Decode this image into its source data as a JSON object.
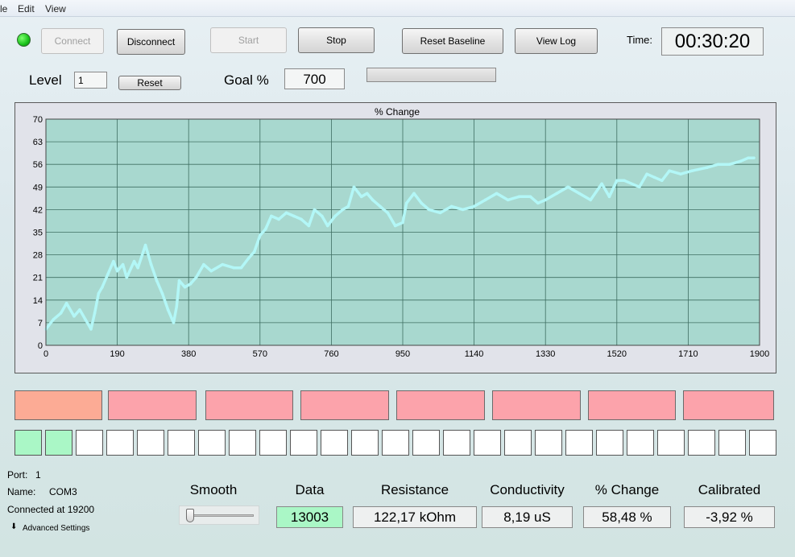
{
  "menu": {
    "file": "le",
    "edit": "Edit",
    "view": "View"
  },
  "toolbar": {
    "connect": "Connect",
    "disconnect": "Disconnect",
    "start": "Start",
    "stop": "Stop",
    "reset_baseline": "Reset Baseline",
    "view_log": "View Log",
    "time_label": "Time:",
    "time_value": "00:30:20"
  },
  "level": {
    "label": "Level",
    "value": "1",
    "reset": "Reset"
  },
  "goal": {
    "label": "Goal %",
    "value": "700",
    "progress": 0
  },
  "status_colors": {
    "connected_led": "#18c11a",
    "active_block": "#fcab95",
    "inactive_block": "#fca3ab",
    "active_square": "#aaf7c6"
  },
  "blocks": [
    {
      "state": "active"
    },
    {
      "state": "inactive"
    },
    {
      "state": "inactive"
    },
    {
      "state": "inactive"
    },
    {
      "state": "inactive"
    },
    {
      "state": "inactive"
    },
    {
      "state": "inactive"
    },
    {
      "state": "inactive"
    }
  ],
  "squares": {
    "total": 25,
    "filled": 2
  },
  "port": {
    "port_label": "Port:",
    "port_value": "1",
    "name_label": "Name:",
    "name_value": "COM3",
    "connected": "Connected at 19200",
    "advanced": "Advanced Settings"
  },
  "smooth": {
    "label": "Smooth",
    "value": 0
  },
  "stats": [
    {
      "label": "Data",
      "value": "13003",
      "highlight": true
    },
    {
      "label": "Resistance",
      "value": "122,17 kOhm"
    },
    {
      "label": "Conductivity",
      "value": "8,19 uS"
    },
    {
      "label": "% Change",
      "value": "58,48 %"
    },
    {
      "label": "Calibrated",
      "value": "-3,92 %"
    }
  ],
  "chart_data": {
    "type": "line",
    "title": "% Change",
    "xlabel": "",
    "ylabel": "",
    "xlim": [
      0,
      1900
    ],
    "ylim": [
      0,
      70
    ],
    "xticks": [
      "0",
      "190",
      "380",
      "570",
      "760",
      "950",
      "1140",
      "1330",
      "1520",
      "1710",
      "1900"
    ],
    "yticks": [
      "0",
      "7",
      "14",
      "21",
      "28",
      "35",
      "42",
      "49",
      "56",
      "63",
      "70"
    ],
    "grid": true,
    "background": "#a8d8cf",
    "line_color": "#b3f7f7",
    "series": [
      {
        "x": [
          0,
          20,
          40,
          55,
          75,
          90,
          105,
          120,
          130,
          140,
          150,
          165,
          180,
          190,
          205,
          215,
          235,
          245,
          265,
          280,
          295,
          310,
          325,
          340,
          348,
          355,
          370,
          385,
          400,
          420,
          440,
          470,
          500,
          520,
          540,
          555,
          570,
          585,
          600,
          620,
          640,
          660,
          680,
          700,
          715,
          735,
          750,
          770,
          790,
          805,
          820,
          840,
          855,
          870,
          890,
          910,
          930,
          950,
          960,
          980,
          1000,
          1020,
          1050,
          1080,
          1110,
          1140,
          1170,
          1200,
          1230,
          1260,
          1290,
          1310,
          1330,
          1360,
          1390,
          1420,
          1450,
          1480,
          1500,
          1520,
          1540,
          1580,
          1600,
          1620,
          1640,
          1660,
          1690,
          1720,
          1760,
          1790,
          1820,
          1850,
          1870,
          1885
        ],
        "y": [
          5,
          8,
          10,
          13,
          9,
          11,
          8,
          5,
          10,
          16,
          18,
          22,
          26,
          23,
          25,
          21,
          26,
          24,
          31,
          25,
          20,
          16,
          11,
          7,
          12,
          20,
          18,
          19,
          21,
          25,
          23,
          25,
          24,
          24,
          27,
          29,
          34,
          36,
          40,
          39,
          41,
          40,
          39,
          37,
          42,
          40,
          37,
          40,
          42,
          43,
          49,
          46,
          47,
          45,
          43,
          41,
          37,
          38,
          44,
          47,
          44,
          42,
          41,
          43,
          42,
          43,
          45,
          47,
          45,
          46,
          46,
          44,
          45,
          47,
          49,
          47,
          45,
          50,
          46,
          51,
          51,
          49,
          53,
          52,
          51,
          54,
          53,
          54,
          55,
          56,
          56,
          57,
          58,
          58
        ]
      }
    ]
  }
}
